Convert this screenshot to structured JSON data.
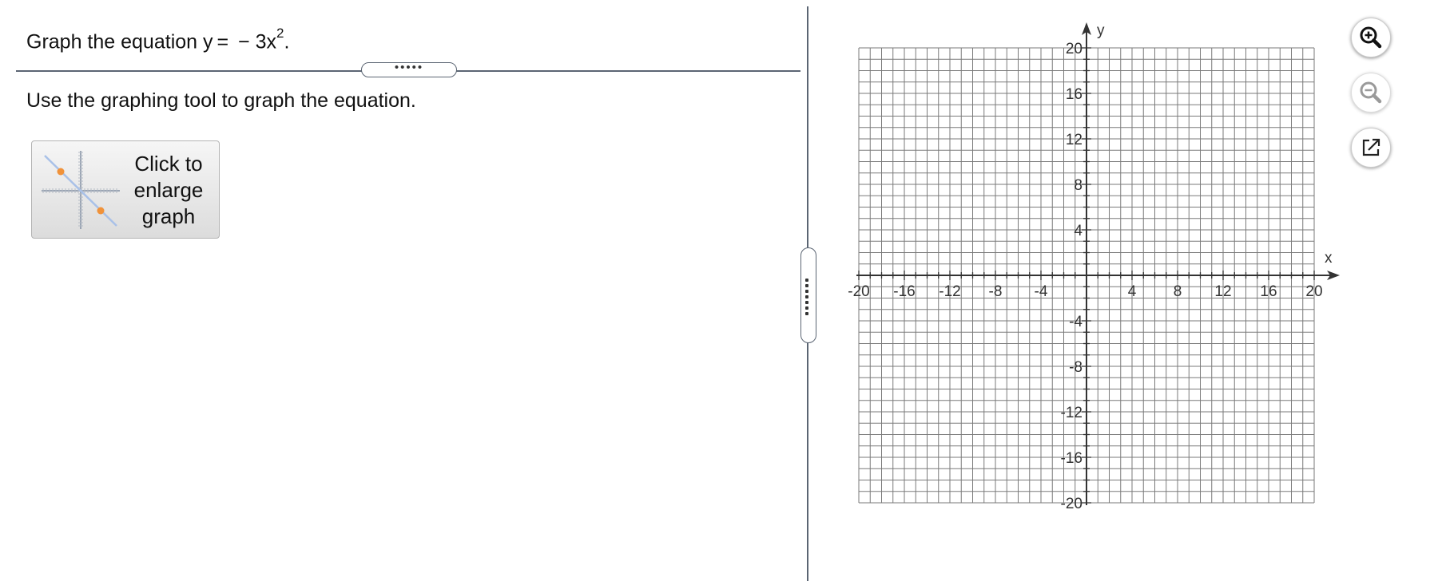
{
  "question": {
    "prefix": "Graph the equation y =  − 3x",
    "exponent": "2",
    "suffix": "."
  },
  "divider_grip": "•••••",
  "instruction": "Use the graphing tool to graph the equation.",
  "enlarge_button": {
    "line1": "Click to",
    "line2": "enlarge",
    "line3": "graph"
  },
  "toolbar": {
    "zoom_in_icon": "zoom-in-icon",
    "zoom_out_icon": "zoom-out-icon",
    "popout_icon": "external-link-icon"
  },
  "colors": {
    "grid": "#7a7a7a",
    "axis": "#333333",
    "separator": "#5b6573",
    "thumb_line": "#a9c1e8",
    "thumb_point": "#f0923a"
  },
  "chart_data": {
    "type": "scatter",
    "xlabel": "x",
    "ylabel": "y",
    "xlim": [
      -20,
      20
    ],
    "ylim": [
      -20,
      20
    ],
    "grid": true,
    "grid_step": 1,
    "x_ticks": [
      -20,
      -16,
      -12,
      -8,
      -4,
      4,
      8,
      12,
      16,
      20
    ],
    "y_ticks": [
      20,
      16,
      12,
      8,
      4,
      -4,
      -8,
      -12,
      -16,
      -20
    ],
    "series": []
  }
}
